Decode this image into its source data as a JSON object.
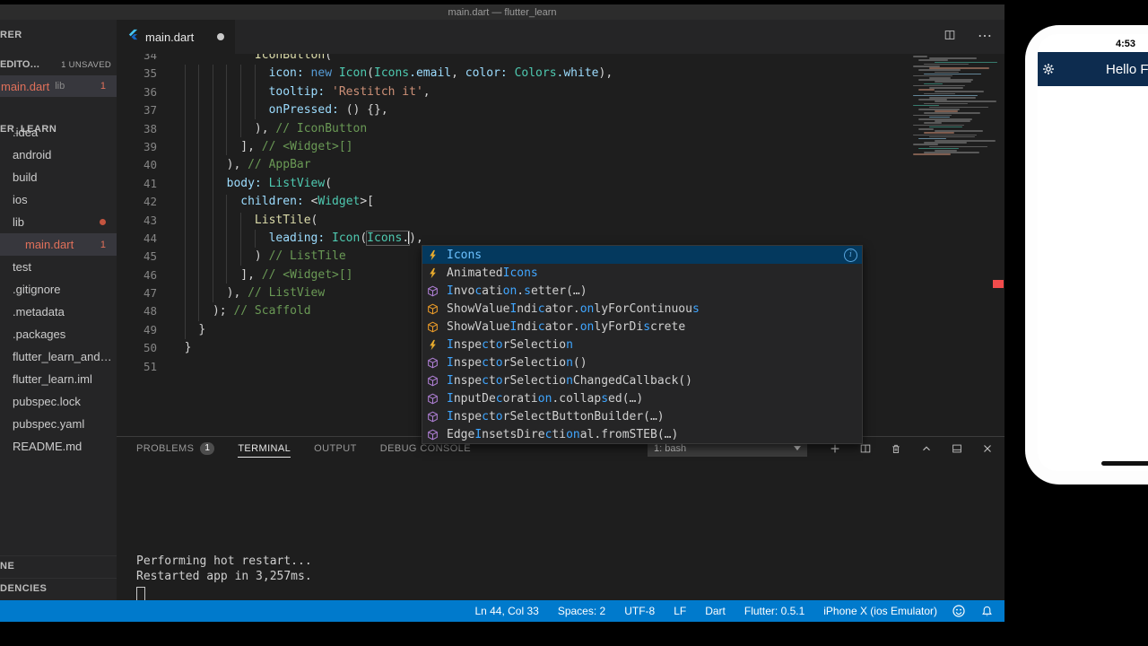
{
  "title_bar": {
    "title": "main.dart — flutter_learn"
  },
  "icons": {
    "more": "⋯"
  },
  "tab": {
    "label": "main.dart"
  },
  "sidebar": {
    "explorer_header": "RER",
    "open_editors": {
      "header": "EDITO…",
      "badge": "1 UNSAVED",
      "items": [
        {
          "name": "main.dart",
          "path": "lib",
          "badge": "1"
        }
      ]
    },
    "project": {
      "header": "ER_LEARN",
      "items": [
        {
          "label": ".idea"
        },
        {
          "label": "android"
        },
        {
          "label": "build"
        },
        {
          "label": "ios"
        },
        {
          "label": "lib",
          "dot": true
        },
        {
          "label": "main.dart",
          "selected": true,
          "warm": true,
          "badge": "1",
          "indent": 1
        },
        {
          "label": "test"
        },
        {
          "label": ".gitignore"
        },
        {
          "label": ".metadata"
        },
        {
          "label": ".packages"
        },
        {
          "label": "flutter_learn_and…"
        },
        {
          "label": "flutter_learn.iml"
        },
        {
          "label": "pubspec.lock"
        },
        {
          "label": "pubspec.yaml"
        },
        {
          "label": "README.md"
        }
      ]
    },
    "bottom_sections": [
      {
        "label": "NE"
      },
      {
        "label": "DENCIES"
      }
    ]
  },
  "editor": {
    "lines": [
      {
        "n": 34,
        "ind": 12,
        "toks": [
          [
            "IconButton",
            "fn"
          ],
          [
            "(",
            "pln"
          ]
        ]
      },
      {
        "n": 35,
        "ind": 14,
        "toks": [
          [
            "icon:",
            "prop"
          ],
          [
            " ",
            "pln"
          ],
          [
            "new",
            "kw"
          ],
          [
            " ",
            "pln"
          ],
          [
            "Icon",
            "cls"
          ],
          [
            "(",
            "pln"
          ],
          [
            "Icons",
            "cls"
          ],
          [
            ".email",
            "prop"
          ],
          [
            ", ",
            "pln"
          ],
          [
            "color:",
            "prop"
          ],
          [
            " ",
            "pln"
          ],
          [
            "Colors",
            "cls"
          ],
          [
            ".white",
            "prop"
          ],
          [
            "),",
            "pln"
          ]
        ]
      },
      {
        "n": 36,
        "ind": 14,
        "toks": [
          [
            "tooltip:",
            "prop"
          ],
          [
            " ",
            "pln"
          ],
          [
            "'Restitch it'",
            "str"
          ],
          [
            ",",
            "pln"
          ]
        ]
      },
      {
        "n": 37,
        "ind": 14,
        "toks": [
          [
            "onPressed:",
            "prop"
          ],
          [
            " ",
            "pln"
          ],
          [
            "() {},",
            "pln"
          ]
        ]
      },
      {
        "n": 38,
        "ind": 12,
        "toks": [
          [
            "), ",
            "pln"
          ],
          [
            "// IconButton",
            "com"
          ]
        ]
      },
      {
        "n": 39,
        "ind": 10,
        "toks": [
          [
            "], ",
            "pln"
          ],
          [
            "// <Widget>[]",
            "com"
          ]
        ]
      },
      {
        "n": 40,
        "ind": 8,
        "toks": [
          [
            "), ",
            "pln"
          ],
          [
            "// AppBar",
            "com"
          ]
        ]
      },
      {
        "n": 41,
        "ind": 8,
        "toks": [
          [
            "body:",
            "prop"
          ],
          [
            " ",
            "pln"
          ],
          [
            "ListView",
            "cls"
          ],
          [
            "(",
            "pln"
          ]
        ]
      },
      {
        "n": 42,
        "ind": 10,
        "toks": [
          [
            "children:",
            "prop"
          ],
          [
            " ",
            "pln"
          ],
          [
            "<",
            "pln"
          ],
          [
            "Widget",
            "cls"
          ],
          [
            ">[",
            "pln"
          ]
        ]
      },
      {
        "n": 43,
        "ind": 12,
        "toks": [
          [
            "ListTile",
            "fn"
          ],
          [
            "(",
            "pln"
          ]
        ]
      },
      {
        "n": 44,
        "ind": 14,
        "toks": [
          [
            "leading:",
            "prop"
          ],
          [
            " ",
            "pln"
          ],
          [
            "Icon",
            "cls"
          ],
          [
            "(",
            "pln"
          ],
          [
            "Icons",
            "cls box"
          ],
          [
            ".",
            "pln box"
          ],
          [
            "",
            "cursor"
          ],
          [
            "),",
            "pln"
          ]
        ]
      },
      {
        "n": 45,
        "ind": 12,
        "toks": [
          [
            ") ",
            "pln"
          ],
          [
            "// ListTile",
            "com"
          ]
        ]
      },
      {
        "n": 46,
        "ind": 10,
        "toks": [
          [
            "], ",
            "pln"
          ],
          [
            "// <Widget>[]",
            "com"
          ]
        ]
      },
      {
        "n": 47,
        "ind": 8,
        "toks": [
          [
            "), ",
            "pln"
          ],
          [
            "// ListView",
            "com"
          ]
        ]
      },
      {
        "n": 48,
        "ind": 6,
        "toks": [
          [
            "); ",
            "pln"
          ],
          [
            "// Scaffold",
            "com"
          ]
        ]
      },
      {
        "n": 49,
        "ind": 4,
        "toks": [
          [
            "}",
            "pln"
          ]
        ]
      },
      {
        "n": 50,
        "ind": 2,
        "toks": [
          [
            "}",
            "pln"
          ]
        ]
      },
      {
        "n": 51,
        "ind": 0,
        "toks": []
      }
    ]
  },
  "suggest": {
    "items": [
      {
        "kind": "class",
        "selected": true,
        "info": true,
        "segs": [
          [
            "Icons",
            1
          ]
        ]
      },
      {
        "kind": "class",
        "segs": [
          [
            "Animated",
            0
          ],
          [
            "Icons",
            1
          ]
        ]
      },
      {
        "kind": "method",
        "segs": [
          [
            "I",
            1
          ],
          [
            "nvo",
            0
          ],
          [
            "c",
            1
          ],
          [
            "ati",
            0
          ],
          [
            "on",
            1
          ],
          [
            ".",
            0
          ],
          [
            "s",
            1
          ],
          [
            "etter(…)",
            0
          ]
        ]
      },
      {
        "kind": "field",
        "segs": [
          [
            "ShowValue",
            0
          ],
          [
            "I",
            1
          ],
          [
            "ndi",
            0
          ],
          [
            "c",
            1
          ],
          [
            "ator.",
            0
          ],
          [
            "on",
            1
          ],
          [
            "lyForContinuou",
            0
          ],
          [
            "s",
            1
          ]
        ]
      },
      {
        "kind": "field",
        "segs": [
          [
            "ShowValue",
            0
          ],
          [
            "I",
            1
          ],
          [
            "ndi",
            0
          ],
          [
            "c",
            1
          ],
          [
            "ator.",
            0
          ],
          [
            "on",
            1
          ],
          [
            "lyForDi",
            0
          ],
          [
            "s",
            1
          ],
          [
            "crete",
            0
          ]
        ]
      },
      {
        "kind": "class",
        "segs": [
          [
            "I",
            1
          ],
          [
            "nspe",
            0
          ],
          [
            "c",
            1
          ],
          [
            "t",
            0
          ],
          [
            "o",
            1
          ],
          [
            "rSelectio",
            0
          ],
          [
            "n",
            1
          ]
        ]
      },
      {
        "kind": "method",
        "segs": [
          [
            "I",
            1
          ],
          [
            "nspe",
            0
          ],
          [
            "c",
            1
          ],
          [
            "t",
            0
          ],
          [
            "o",
            1
          ],
          [
            "rSelectio",
            0
          ],
          [
            "n",
            1
          ],
          [
            "()",
            0
          ]
        ]
      },
      {
        "kind": "method",
        "segs": [
          [
            "I",
            1
          ],
          [
            "nspe",
            0
          ],
          [
            "c",
            1
          ],
          [
            "t",
            0
          ],
          [
            "o",
            1
          ],
          [
            "rSelectio",
            0
          ],
          [
            "n",
            1
          ],
          [
            "ChangedCallback()",
            0
          ]
        ]
      },
      {
        "kind": "method",
        "segs": [
          [
            "I",
            1
          ],
          [
            "nputDe",
            0
          ],
          [
            "c",
            1
          ],
          [
            "orati",
            0
          ],
          [
            "on",
            1
          ],
          [
            ".collap",
            0
          ],
          [
            "s",
            1
          ],
          [
            "ed(…)",
            0
          ]
        ]
      },
      {
        "kind": "method",
        "segs": [
          [
            "I",
            1
          ],
          [
            "nspe",
            0
          ],
          [
            "c",
            1
          ],
          [
            "t",
            0
          ],
          [
            "o",
            1
          ],
          [
            "rSelectButtonBuilder(…)",
            0
          ]
        ]
      },
      {
        "kind": "method",
        "segs": [
          [
            "Edge",
            0
          ],
          [
            "I",
            1
          ],
          [
            "nsetsDire",
            0
          ],
          [
            "c",
            1
          ],
          [
            "ti",
            0
          ],
          [
            "on",
            1
          ],
          [
            "al.fromSTEB(…)",
            0
          ]
        ]
      }
    ]
  },
  "panel": {
    "tabs": [
      {
        "label": "PROBLEMS",
        "badge": "1"
      },
      {
        "label": "TERMINAL",
        "active": true
      },
      {
        "label": "OUTPUT"
      },
      {
        "label": "DEBUG CONSOLE"
      }
    ],
    "shell_select": "1: bash",
    "terminal_lines": [
      "Performing hot restart...",
      "Restarted app in 3,257ms."
    ]
  },
  "status_bar": {
    "items": [
      "Ln 44, Col 33",
      "Spaces: 2",
      "UTF-8",
      "LF",
      "Dart",
      "Flutter: 0.5.1",
      "iPhone X (ios Emulator)"
    ]
  },
  "phone": {
    "time": "4:53",
    "app_title": "Hello Flut"
  },
  "colors": {
    "status_bar": "#007acc",
    "suggest_selected": "#04395e",
    "match_highlight": "#40a6ff",
    "error": "#f14c4c",
    "modified_file": "#e0705a"
  }
}
